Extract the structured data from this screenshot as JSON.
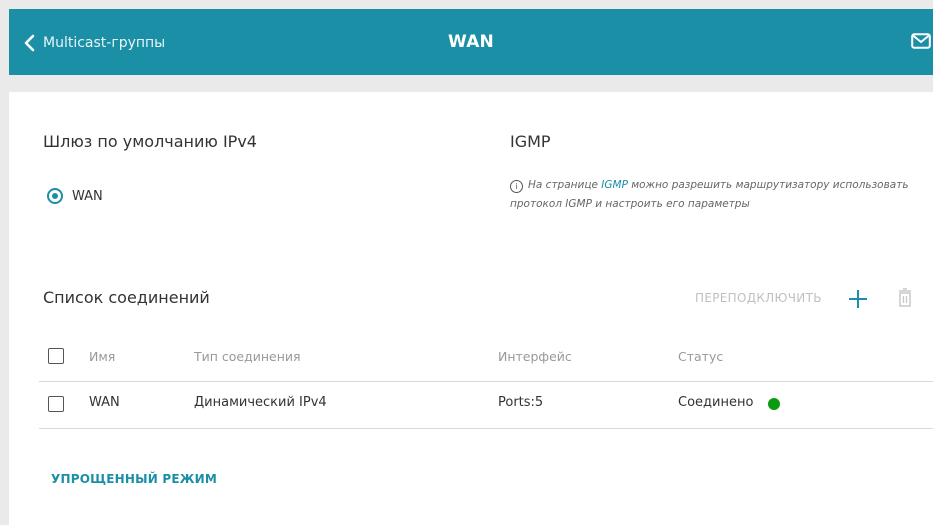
{
  "header": {
    "back_label": "Multicast-группы",
    "title": "WAN",
    "mail_icon": "mail-icon"
  },
  "gateway": {
    "heading": "Шлюз по умолчанию IPv4",
    "option_label": "WAN",
    "selected": true
  },
  "igmp": {
    "heading": "IGMP",
    "note_before": "На странице ",
    "note_link": "IGMP",
    "note_after": " можно разрешить маршрутизатору использовать протокол IGMP и настроить его параметры"
  },
  "connections": {
    "heading": "Список соединений",
    "reconnect_label": "ПЕРЕПОДКЛЮЧИТЬ",
    "columns": [
      "Имя",
      "Тип соединения",
      "Интерфейс",
      "Статус"
    ],
    "rows": [
      {
        "name": "WAN",
        "type": "Динамический IPv4",
        "interface": "Ports:5",
        "status": "Соединено",
        "status_color": "#0a9b10"
      }
    ]
  },
  "footer": {
    "simple_mode_label": "УПРОЩЕННЫЙ РЕЖИМ"
  },
  "colors": {
    "accent": "#1a8fa6",
    "status_ok": "#0a9b10"
  }
}
